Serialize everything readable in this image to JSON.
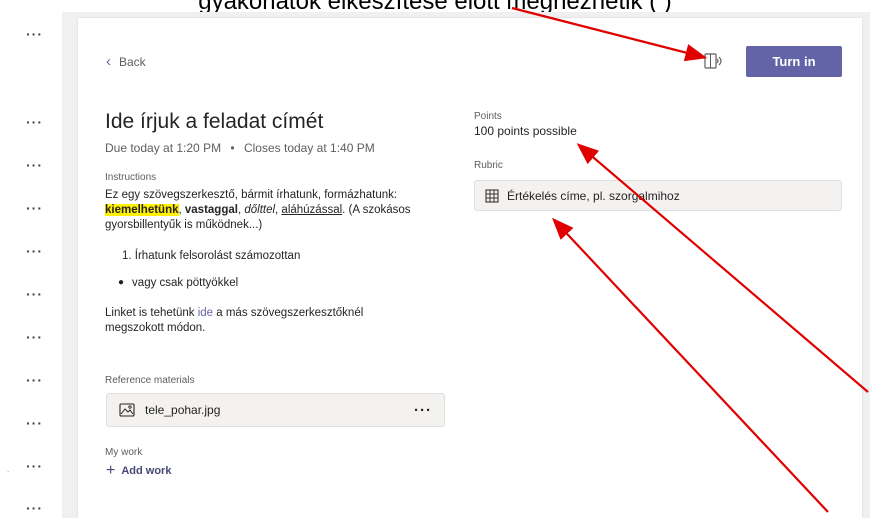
{
  "top_caption": "gyakorlatok elkészítése előtt megnézhetik (  )",
  "nav": {
    "back_label": "Back",
    "turn_in_label": "Turn in"
  },
  "assignment": {
    "title": "Ide írjuk a feladat címét",
    "due_text": "Due today at 1:20 PM",
    "separator": "•",
    "closes_text": "Closes today at 1:40 PM",
    "instructions_label": "Instructions",
    "instructions": {
      "intro": "Ez egy szövegszerkesztő, bármit írhatunk, formázhatunk: ",
      "highlight": "kiemelhetünk",
      "comma1": ", ",
      "bold": "vastaggal",
      "comma2": ", ",
      "italic": "dőlttel",
      "comma3": ", ",
      "underline": "aláhúzással",
      "outro": ". (A szokásos gyorsbillentyűk is működnek...)",
      "numbered_item": "1. Írhatunk felsorolást számozottan",
      "bullet_item": "vagy csak pöttyökkel",
      "link_before": "Linket is tehetünk ",
      "link_text": "ide",
      "link_after": " a más szövegszerkesztőknél megszokott módon."
    },
    "reference_label": "Reference materials",
    "reference_file": "tele_pohar.jpg",
    "my_work_label": "My work",
    "add_work_label": "Add work"
  },
  "side": {
    "points_label": "Points",
    "points_value": "100 points possible",
    "rubric_label": "Rubric",
    "rubric_name": "Értékelés címe, pl. szorgalmihoz"
  },
  "icons": {
    "back": "chevron-left-icon",
    "reader": "immersive-reader-icon",
    "image": "image-file-icon",
    "more": "more-options-icon",
    "add": "plus-icon",
    "rubric": "grid-icon"
  },
  "colors": {
    "accent": "#6264a7",
    "arrow": "#e00000",
    "highlight": "#fff100"
  }
}
